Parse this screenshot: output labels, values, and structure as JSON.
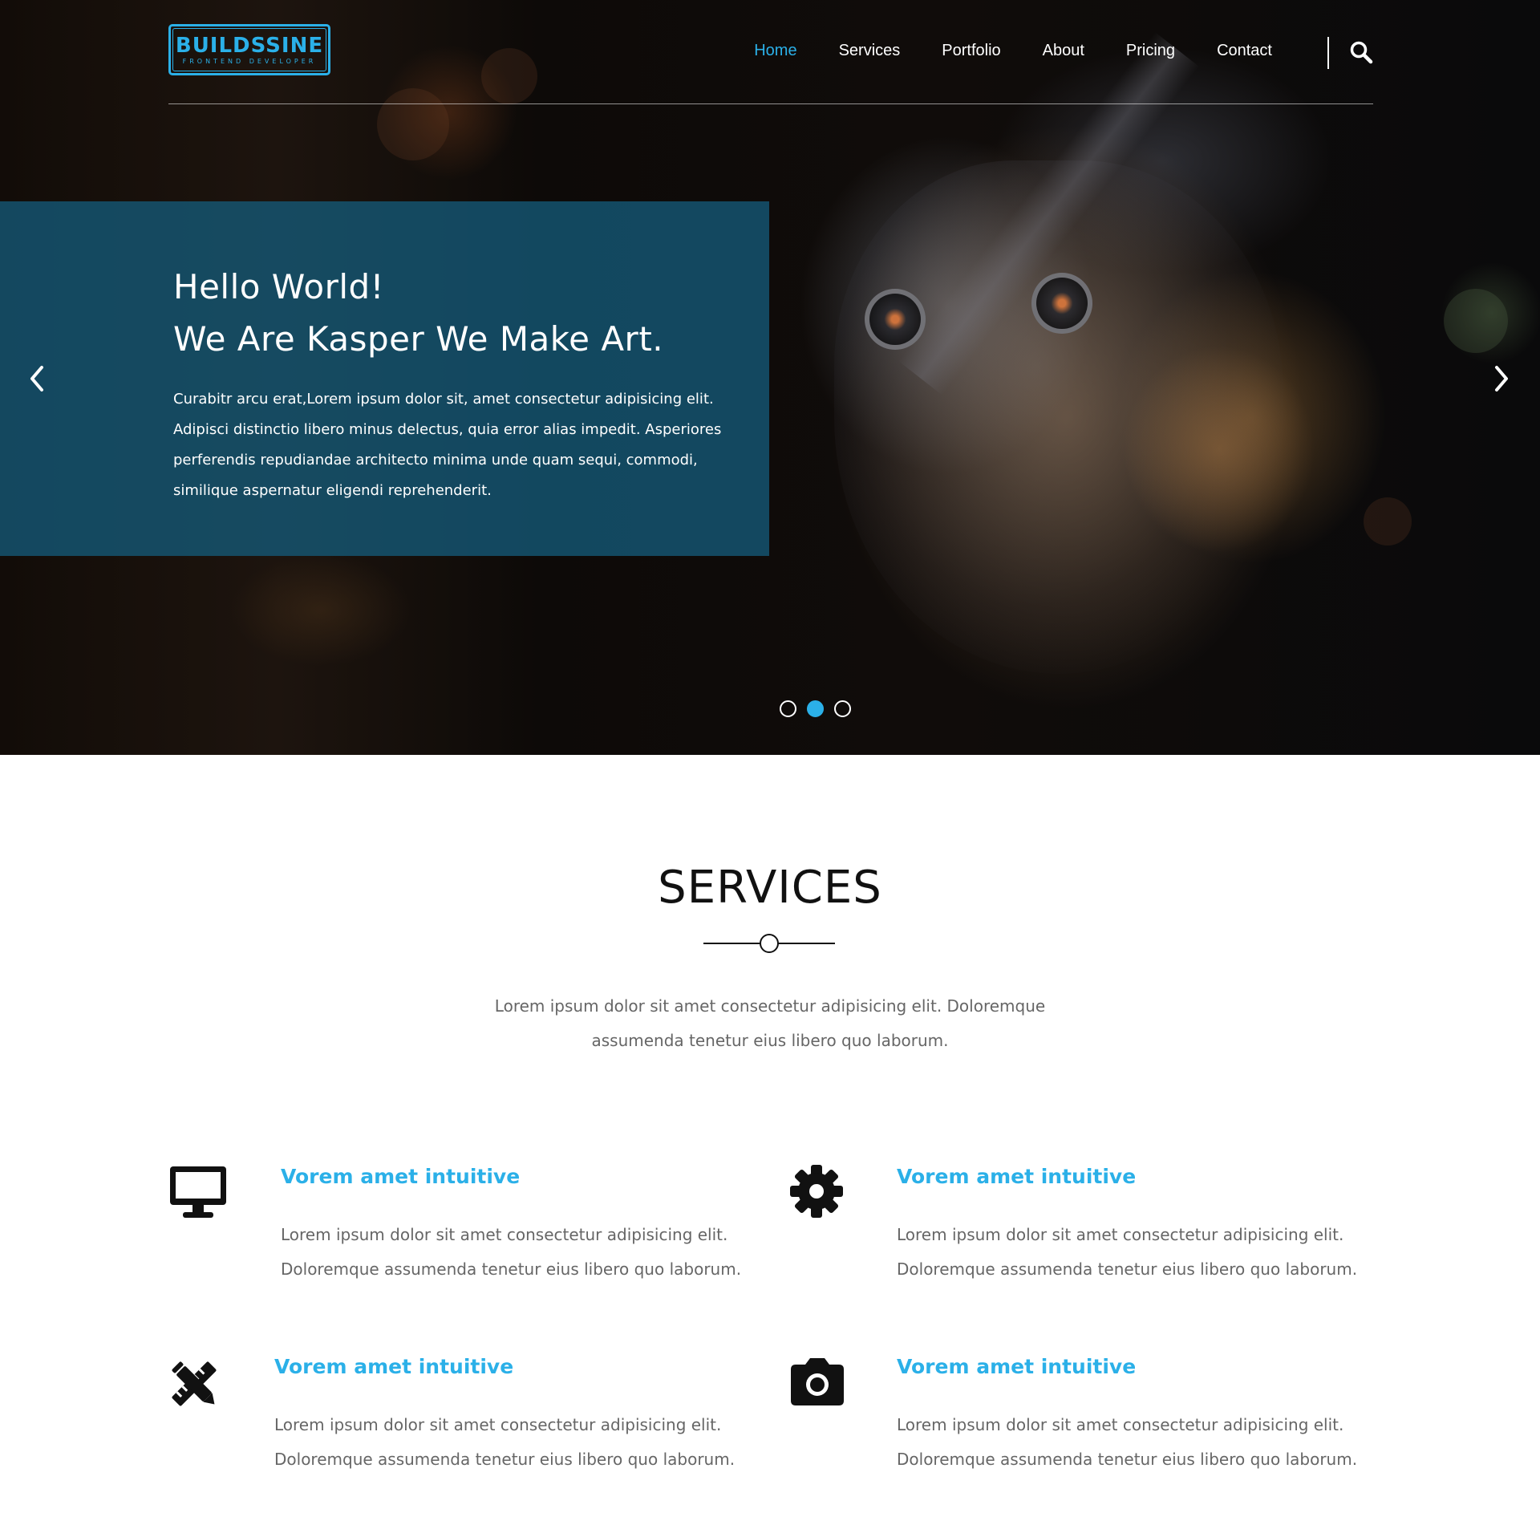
{
  "logo": {
    "main": "BUILDSSINE",
    "sub": "FRONTEND DEVELOPER"
  },
  "nav": {
    "items": [
      {
        "label": "Home",
        "active": true
      },
      {
        "label": "Services",
        "active": false
      },
      {
        "label": "Portfolio",
        "active": false
      },
      {
        "label": "About",
        "active": false
      },
      {
        "label": "Pricing",
        "active": false
      },
      {
        "label": "Contact",
        "active": false
      }
    ],
    "search_icon": "search-icon"
  },
  "hero": {
    "title_line1": "Hello World!",
    "title_line2": "We Are Kasper We Make Art.",
    "text": "Curabitr arcu erat,Lorem ipsum dolor sit, amet consectetur adipisicing elit. Adipisci distinctio libero minus delectus, quia error alias impedit. Asperiores perferendis repudiandae architecto minima unde quam sequi, commodi, similique aspernatur eligendi reprehenderit.",
    "prev_icon": "chevron-left-icon",
    "next_icon": "chevron-right-icon",
    "slides_total": 3,
    "active_slide": 2
  },
  "services": {
    "title": "SERVICES",
    "intro": "Lorem ipsum dolor sit amet consectetur adipisicing elit. Doloremque assumenda tenetur eius libero quo laborum.",
    "items": [
      {
        "icon": "desktop-icon",
        "title": "Vorem amet intuitive",
        "text": "Lorem ipsum dolor sit amet consectetur adipisicing elit. Doloremque assumenda tenetur eius libero quo laborum."
      },
      {
        "icon": "gear-icon",
        "title": "Vorem amet intuitive",
        "text": "Lorem ipsum dolor sit amet consectetur adipisicing elit. Doloremque assumenda tenetur eius libero quo laborum."
      },
      {
        "icon": "pencil-ruler-icon",
        "title": "Vorem amet intuitive",
        "text": "Lorem ipsum dolor sit amet consectetur adipisicing elit. Doloremque assumenda tenetur eius libero quo laborum."
      },
      {
        "icon": "camera-icon",
        "title": "Vorem amet intuitive",
        "text": "Lorem ipsum dolor sit amet consectetur adipisicing elit. Doloremque assumenda tenetur eius libero quo laborum."
      }
    ]
  },
  "colors": {
    "accent": "#2bb0e8",
    "caption_bg": "#145a78",
    "text_muted": "#666666",
    "heading": "#111111"
  }
}
